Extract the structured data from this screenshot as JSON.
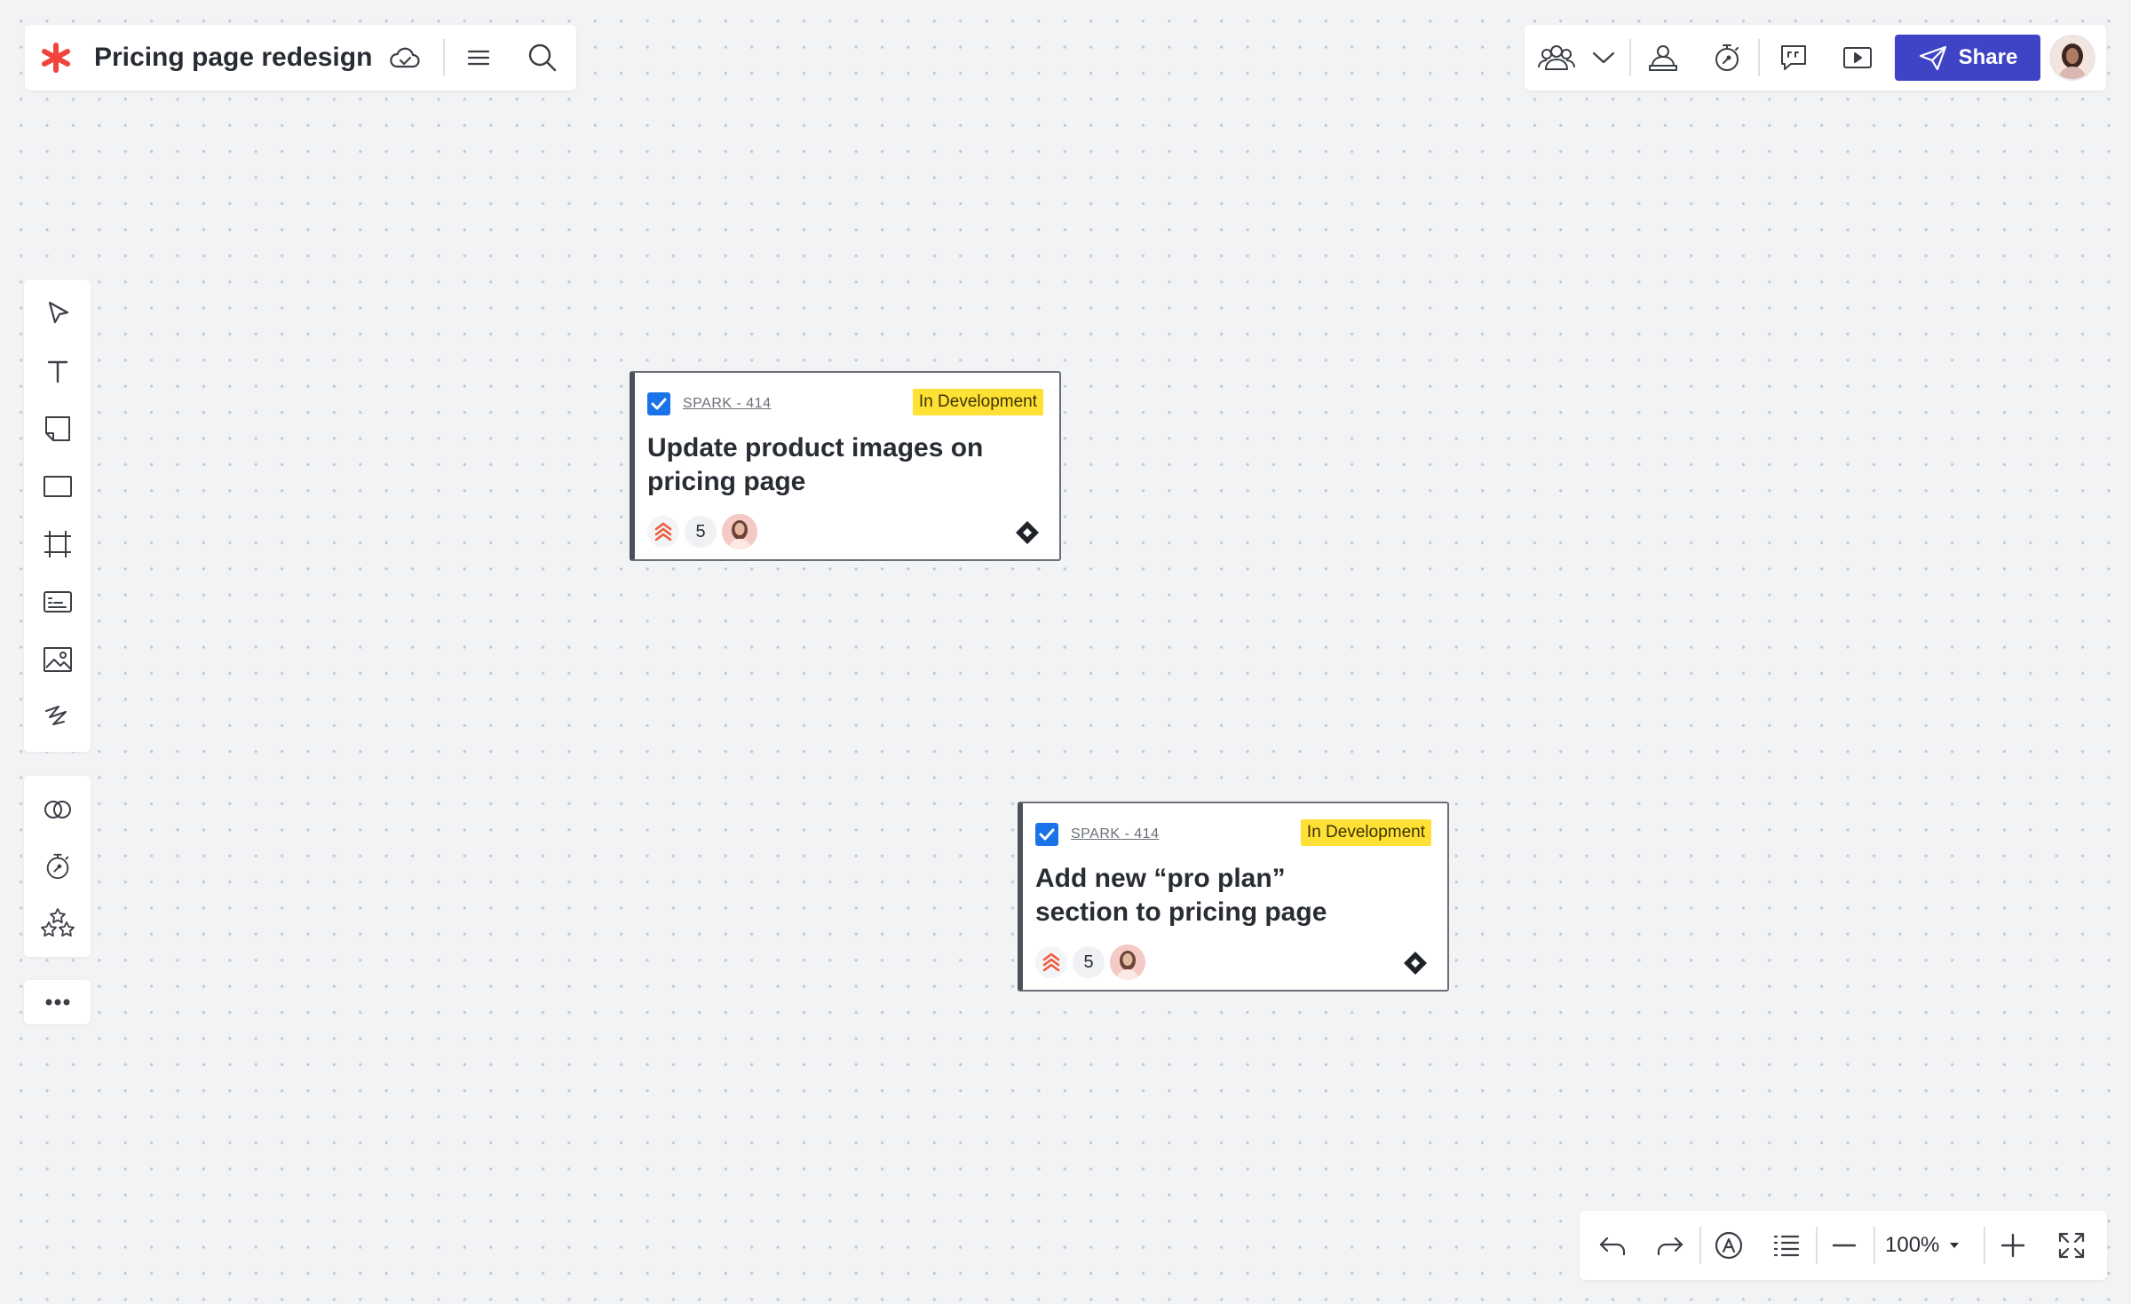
{
  "document": {
    "title": "Pricing page redesign"
  },
  "header": {
    "share_label": "Share"
  },
  "cards": [
    {
      "key": "SPARK - 414",
      "status": "In Development",
      "title": "Update product images on pricing page",
      "points": "5"
    },
    {
      "key": "SPARK - 414",
      "status": "In Development",
      "title": "Add new  “pro plan” section to pricing page",
      "points": "5"
    }
  ],
  "bottom_toolbar": {
    "zoom": "100%"
  },
  "colors": {
    "canvas": "#f2f3f5",
    "accent": "#3f43c6",
    "logo": "#f2443c",
    "status_badge": "#ffe135",
    "checkbox": "#1a73e8",
    "priority": "#f05a3c"
  },
  "icons": {
    "header_left": [
      "asterisk-logo-icon",
      "cloud-check-icon",
      "hamburger-menu-icon",
      "search-icon"
    ],
    "header_right": [
      "collaborators-icon",
      "chevron-down-icon",
      "presenter-icon",
      "timer-icon",
      "comments-icon",
      "present-play-icon",
      "send-icon"
    ],
    "tools": [
      "select-arrow-icon",
      "text-icon",
      "sticky-note-icon",
      "rectangle-icon",
      "frame-icon",
      "card-icon",
      "image-icon",
      "pen-icon",
      "integrations-icon",
      "timer-icon",
      "star-rating-icon",
      "more-icon"
    ],
    "bottom": [
      "undo-icon",
      "redo-icon",
      "auto-icon",
      "list-icon",
      "zoom-out-icon",
      "zoom-in-icon",
      "fullscreen-icon"
    ]
  }
}
